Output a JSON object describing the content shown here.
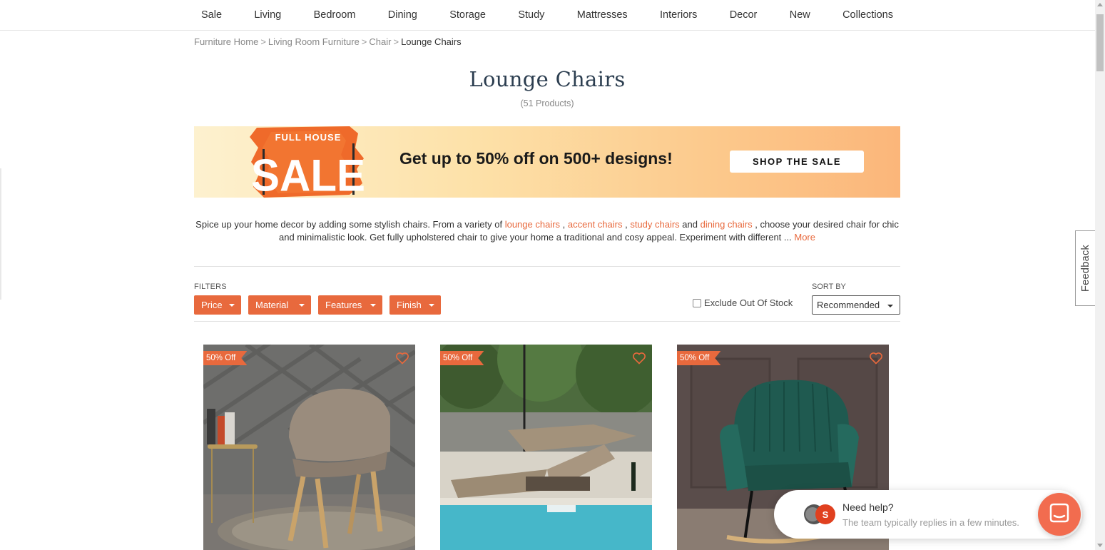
{
  "nav": {
    "items": [
      "Sale",
      "Living",
      "Bedroom",
      "Dining",
      "Storage",
      "Study",
      "Mattresses",
      "Interiors",
      "Decor",
      "New",
      "Collections"
    ]
  },
  "breadcrumb": {
    "items": [
      "Furniture Home",
      "Living Room Furniture",
      "Chair"
    ],
    "separator": ">",
    "current": "Lounge Chairs"
  },
  "page": {
    "title": "Lounge Chairs",
    "count": "(51 Products)"
  },
  "banner": {
    "badge_line1": "FULL HOUSE",
    "badge_line2": "SALE",
    "headline": "Get up to 50% off on 500+ designs!",
    "button": "SHOP THE SALE"
  },
  "description": {
    "part1": "Spice up your home decor by adding some stylish chairs. From a variety of ",
    "link1": "lounge chairs",
    "sep1": " , ",
    "link2": "accent chairs",
    "sep2": " , ",
    "link3": "study chairs",
    "and": " and ",
    "link4": "dining chairs",
    "part2": " , choose your desired chair for chic and minimalistic look. Get fully upholstered chair to give your home a traditional and cosy appeal. Experiment with different ... ",
    "more": "More"
  },
  "filters": {
    "label": "FILTERS",
    "buttons": [
      "Price",
      "Material",
      "Features",
      "Finish"
    ],
    "exclude_label": "Exclude Out Of Stock",
    "sort_label": "SORT BY",
    "sort_value": "Recommended"
  },
  "products": [
    {
      "badge": "50% Off"
    },
    {
      "badge": "50% Off"
    },
    {
      "badge": "50% Off"
    }
  ],
  "feedback": {
    "label": "Feedback"
  },
  "chat": {
    "title": "Need help?",
    "subtitle": "The team typically replies in a few minutes."
  },
  "colors": {
    "accent": "#e8693d",
    "title": "#2c3e50",
    "chat_button": "#f26c4f"
  }
}
